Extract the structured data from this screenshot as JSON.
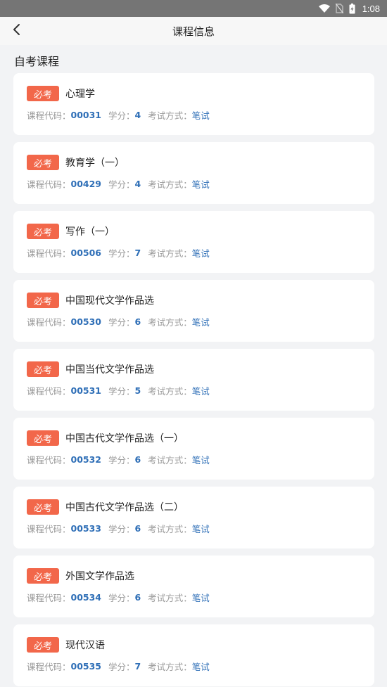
{
  "status_bar": {
    "time": "1:08",
    "icons": [
      "wifi-icon",
      "no-sim-icon",
      "battery-icon"
    ]
  },
  "app_bar": {
    "title": "课程信息",
    "back_icon": "chevron-left-icon"
  },
  "section": {
    "title": "自考课程"
  },
  "labels": {
    "code": "课程代码：",
    "credit": "学分：",
    "exam_mode": "考试方式："
  },
  "courses": [
    {
      "tag": "必考",
      "name": "心理学",
      "code": "00031",
      "credit": "4",
      "exam_mode": "笔试"
    },
    {
      "tag": "必考",
      "name": "教育学（一）",
      "code": "00429",
      "credit": "4",
      "exam_mode": "笔试"
    },
    {
      "tag": "必考",
      "name": "写作（一）",
      "code": "00506",
      "credit": "7",
      "exam_mode": "笔试"
    },
    {
      "tag": "必考",
      "name": "中国现代文学作品选",
      "code": "00530",
      "credit": "6",
      "exam_mode": "笔试"
    },
    {
      "tag": "必考",
      "name": "中国当代文学作品选",
      "code": "00531",
      "credit": "5",
      "exam_mode": "笔试"
    },
    {
      "tag": "必考",
      "name": "中国古代文学作品选（一）",
      "code": "00532",
      "credit": "6",
      "exam_mode": "笔试"
    },
    {
      "tag": "必考",
      "name": "中国古代文学作品选（二）",
      "code": "00533",
      "credit": "6",
      "exam_mode": "笔试"
    },
    {
      "tag": "必考",
      "name": "外国文学作品选",
      "code": "00534",
      "credit": "6",
      "exam_mode": "笔试"
    },
    {
      "tag": "必考",
      "name": "现代汉语",
      "code": "00535",
      "credit": "7",
      "exam_mode": "笔试"
    }
  ],
  "colors": {
    "tag_bg": "#f2674a",
    "value_blue": "#2f6fb7",
    "page_bg": "#f2f3f5",
    "status_bar_bg": "#757575"
  }
}
